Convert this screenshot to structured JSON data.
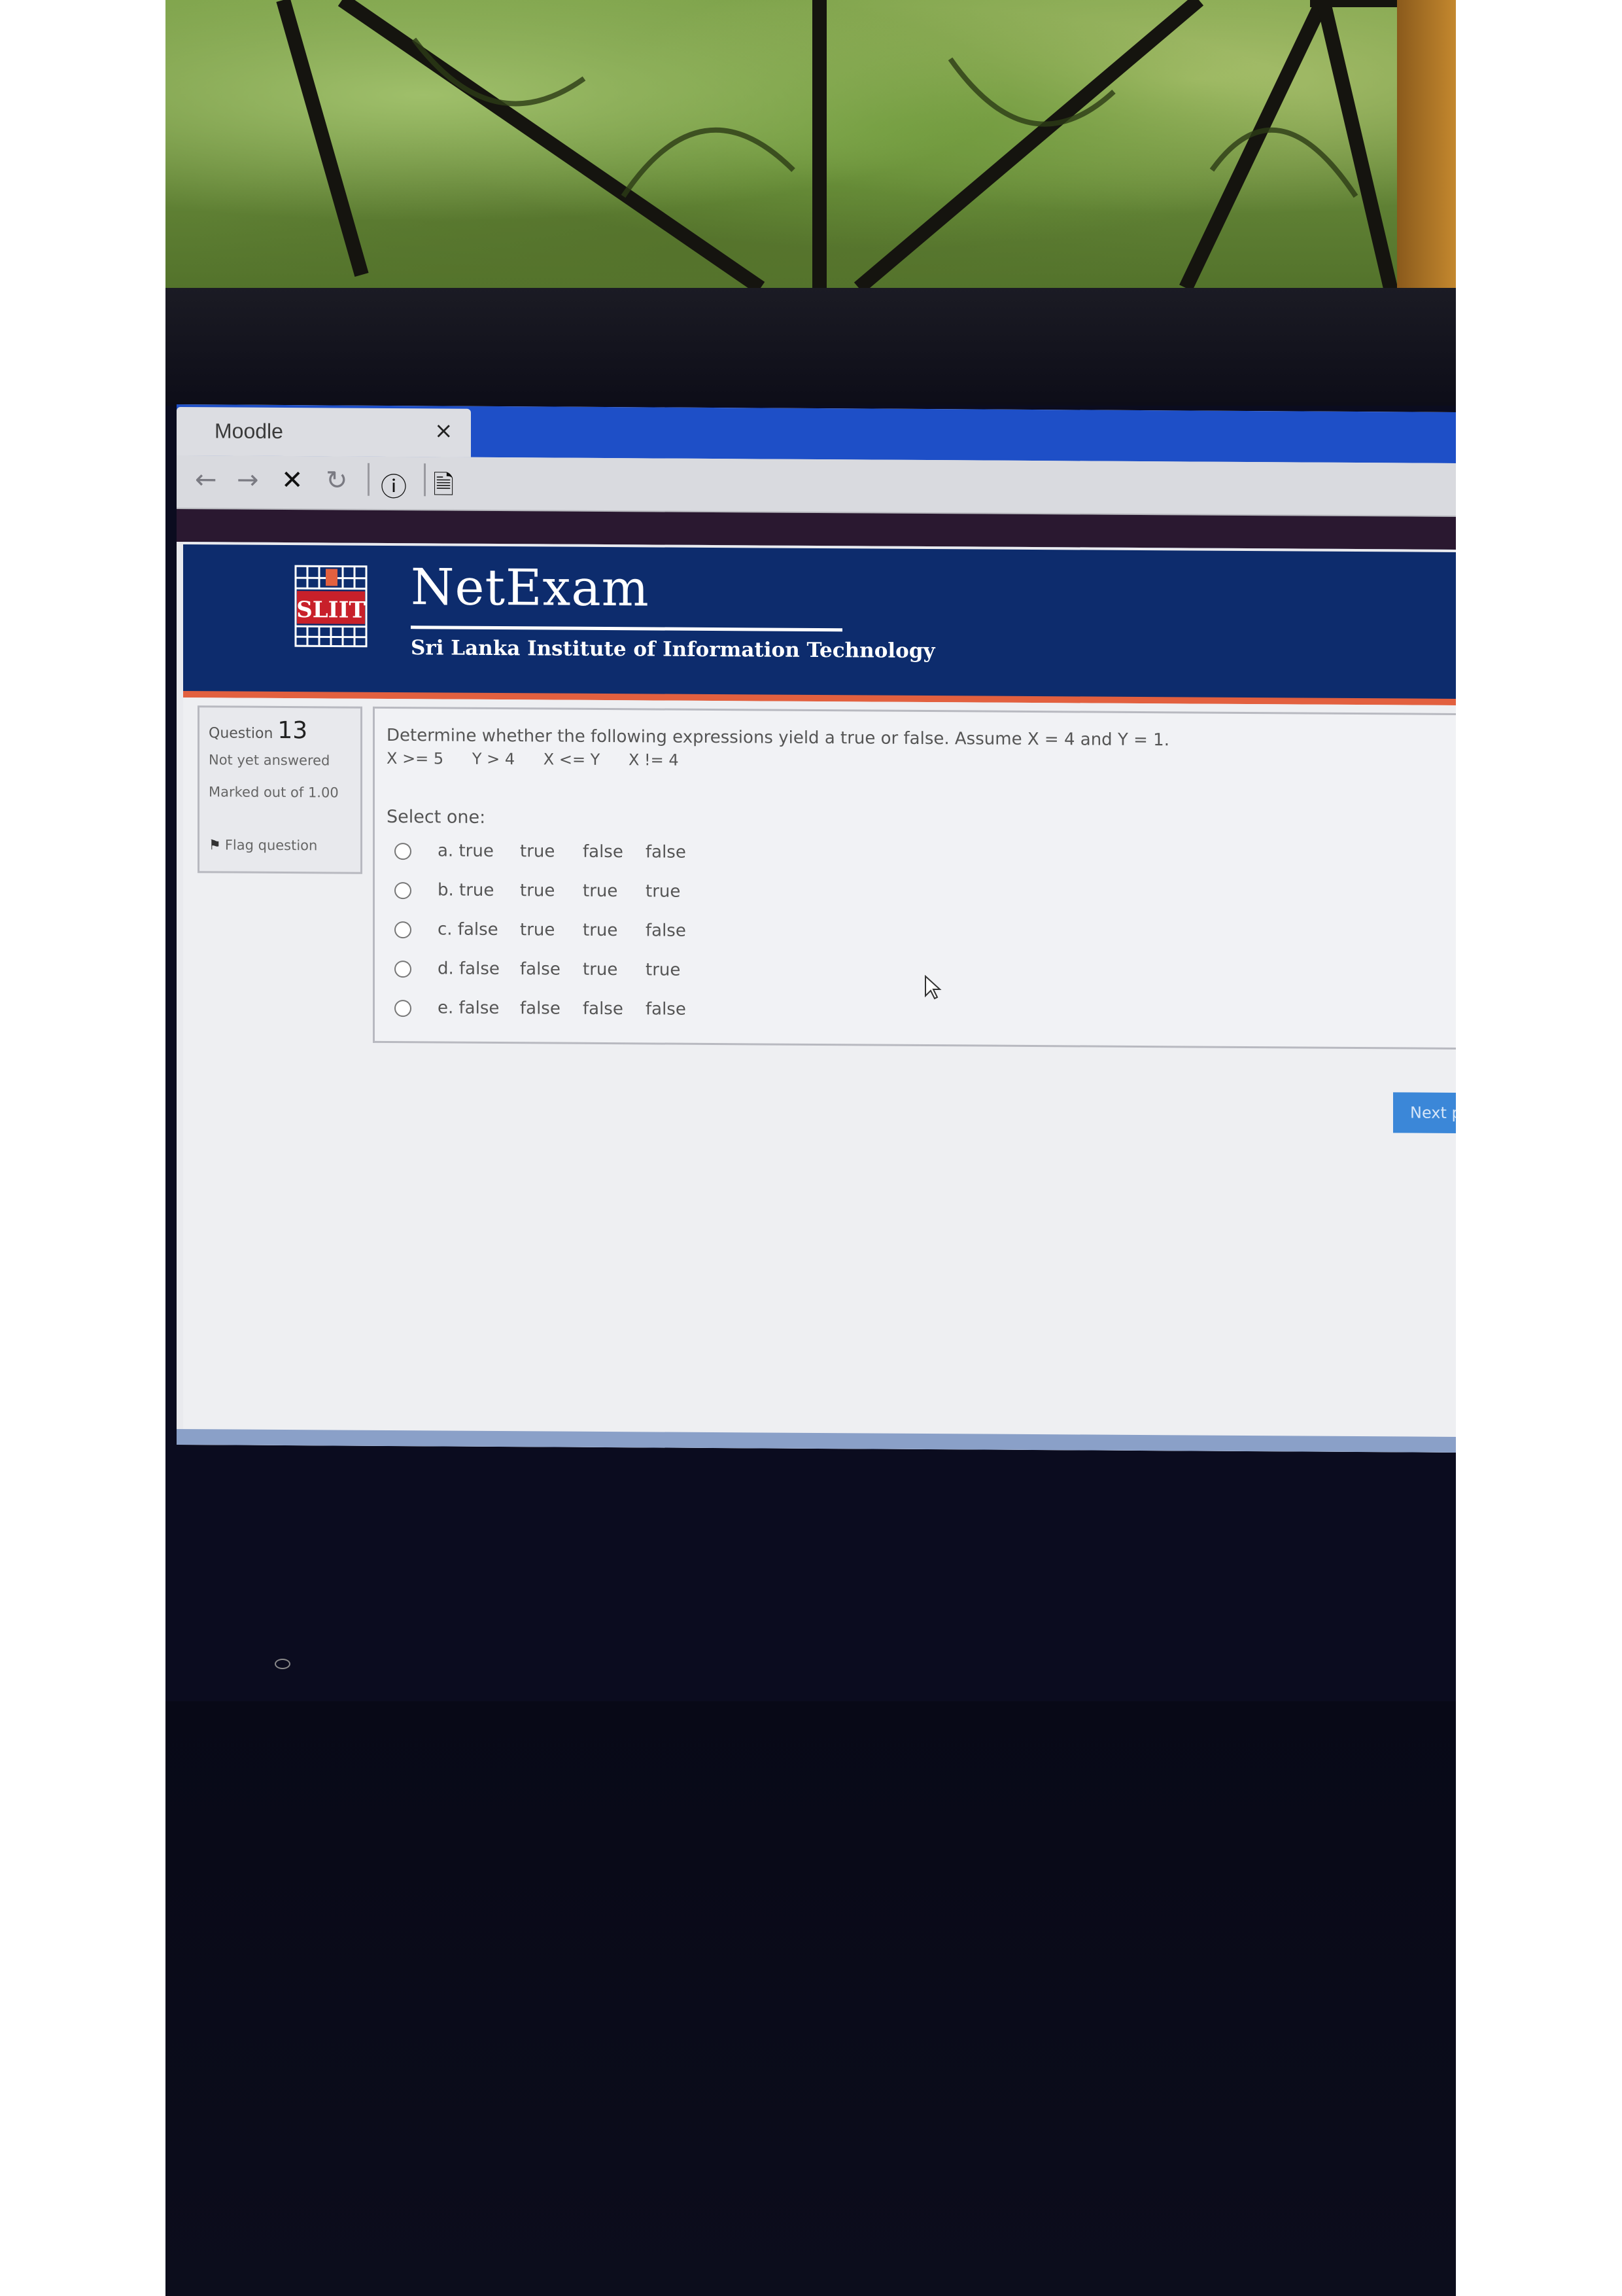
{
  "browser": {
    "tab_title": "Moodle",
    "tab_close": "×",
    "toolbar": {
      "back_icon": "←",
      "forward_icon": "→",
      "stop_icon": "✕",
      "reload_icon": "↻",
      "info_icon": "ⓘ",
      "page_icon": "🗎"
    }
  },
  "site": {
    "logo_text": "SLIIT",
    "brand": "NetExam",
    "subtitle": "Sri Lanka Institute of Information Technology",
    "colors": {
      "header": "#0d2c6d",
      "accent": "#e2603f",
      "button": "#3b87d8"
    }
  },
  "question_info": {
    "label": "Question",
    "number": "13",
    "state": "Not yet answered",
    "marked_out_of": "Marked out of 1.00",
    "flag": "Flag question"
  },
  "question": {
    "text": "Determine whether the following expressions yield a true or false. Assume X = 4 and Y = 1.",
    "expressions": [
      "X >= 5",
      "Y > 4",
      "X <= Y",
      "X != 4"
    ],
    "prompt": "Select one:",
    "options": [
      {
        "label": "a. true",
        "values": [
          "true",
          "false",
          "false"
        ]
      },
      {
        "label": "b. true",
        "values": [
          "true",
          "true",
          "true"
        ]
      },
      {
        "label": "c. false",
        "values": [
          "true",
          "true",
          "false"
        ]
      },
      {
        "label": "d. false",
        "values": [
          "false",
          "true",
          "true"
        ]
      },
      {
        "label": "e. false",
        "values": [
          "false",
          "false",
          "false"
        ]
      }
    ]
  },
  "navigation": {
    "next_label": "Next page"
  }
}
